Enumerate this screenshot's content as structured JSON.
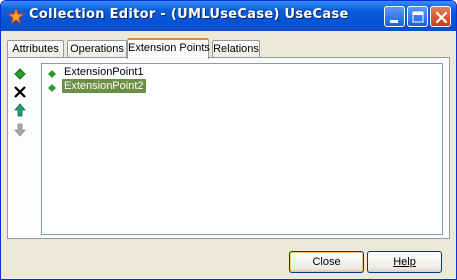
{
  "window": {
    "title": "Collection Editor - (UMLUseCase) UseCase",
    "icons": {
      "app": "star-icon",
      "minimize": "minimize-icon",
      "maximize": "maximize-icon",
      "close": "close-icon"
    }
  },
  "tabs": [
    {
      "label": "Attributes",
      "active": false
    },
    {
      "label": "Operations",
      "active": false
    },
    {
      "label": "Extension Points",
      "active": true
    },
    {
      "label": "Relations",
      "active": false
    }
  ],
  "toolbar": {
    "add": "add-icon",
    "delete": "delete-icon",
    "move_up": "arrow-up-icon",
    "move_down": "arrow-down-icon"
  },
  "list": {
    "items": [
      {
        "label": "ExtensionPoint1",
        "selected": false
      },
      {
        "label": "ExtensionPoint2",
        "selected": true
      }
    ]
  },
  "buttons": {
    "close": "Close",
    "help": "Help"
  },
  "colors": {
    "titlebar": "#0453d6",
    "tab_active_accent": "#e68b2c",
    "selection": "#6a8f45",
    "item_icon": "#2e9b2e"
  }
}
